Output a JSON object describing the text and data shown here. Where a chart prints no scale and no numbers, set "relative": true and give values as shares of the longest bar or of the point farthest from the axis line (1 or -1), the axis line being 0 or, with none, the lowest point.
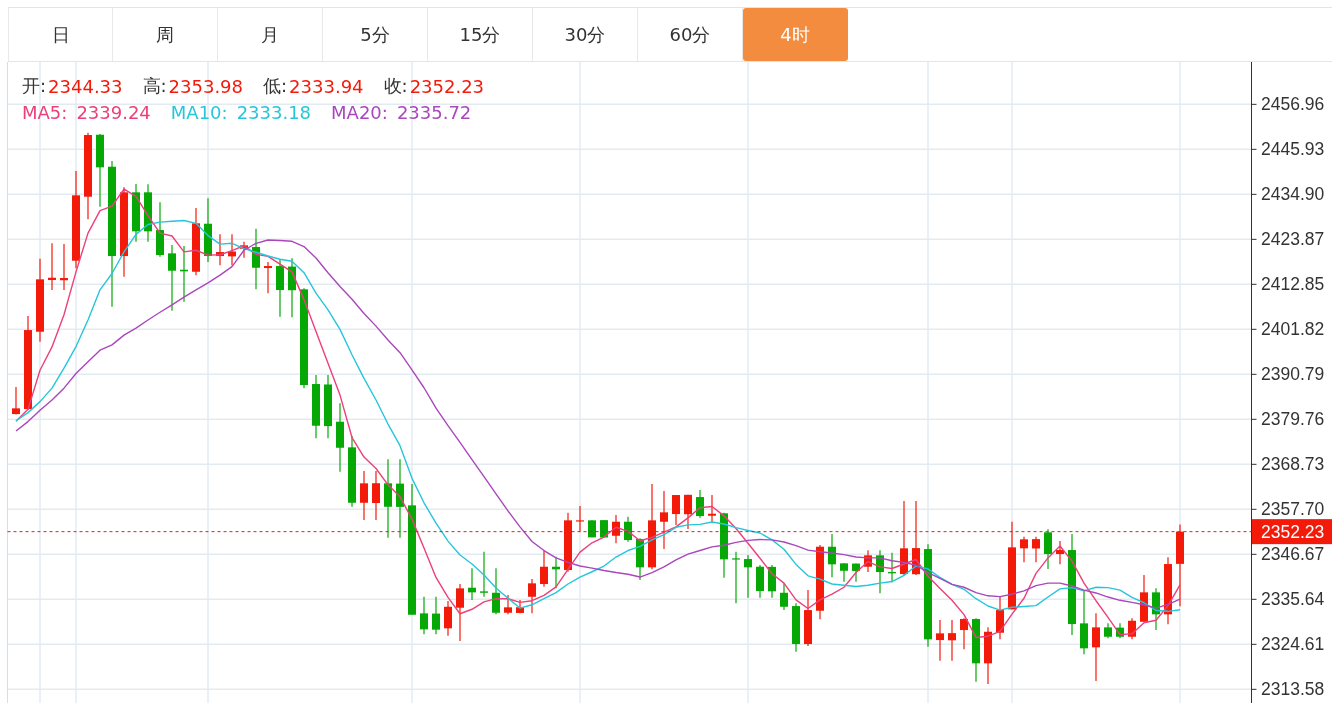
{
  "tabs": [
    {
      "label": "日",
      "selected": false
    },
    {
      "label": "周",
      "selected": false
    },
    {
      "label": "月",
      "selected": false
    },
    {
      "label": "5分",
      "selected": false
    },
    {
      "label": "15分",
      "selected": false
    },
    {
      "label": "30分",
      "selected": false
    },
    {
      "label": "60分",
      "selected": false
    },
    {
      "label": "4时",
      "selected": true
    }
  ],
  "chart": {
    "ohlc_legend": [
      {
        "label": "开:",
        "value": "2344.33"
      },
      {
        "label": "高:",
        "value": "2353.98"
      },
      {
        "label": "低:",
        "value": "2333.94"
      },
      {
        "label": "收:",
        "value": "2352.23"
      }
    ],
    "ma_values": [
      "2339.24",
      "2333.18",
      "2335.72"
    ],
    "last_price_tag": {
      "label": "2352.23"
    },
    "chart_data": {
      "type": "candlestick",
      "ylim": [
        2310.23,
        2467.34
      ],
      "yticks": [
        {
          "value": 2456.96,
          "label": "2456.96"
        },
        {
          "value": 2445.93,
          "label": "2445.93"
        },
        {
          "value": 2434.9,
          "label": "2434.90"
        },
        {
          "value": 2423.87,
          "label": "2423.87"
        },
        {
          "value": 2412.85,
          "label": "2412.85"
        },
        {
          "value": 2401.82,
          "label": "2401.82"
        },
        {
          "value": 2390.79,
          "label": "2390.79"
        },
        {
          "value": 2379.76,
          "label": "2379.76"
        },
        {
          "value": 2368.73,
          "label": "2368.73"
        },
        {
          "value": 2357.7,
          "label": "2357.70"
        },
        {
          "value": 2346.67,
          "label": "2346.67"
        },
        {
          "value": 2335.64,
          "label": "2335.64"
        },
        {
          "value": 2324.61,
          "label": "2324.61"
        },
        {
          "value": 2313.58,
          "label": "2313.58"
        }
      ],
      "grid": true,
      "ohlc": [
        [
          2381.05,
          2387.67,
          2380.93,
          2382.45
        ],
        [
          2382.28,
          2405.08,
          2382.03,
          2401.64
        ],
        [
          2401.23,
          2419.12,
          2398.78,
          2414.07
        ],
        [
          2413.9,
          2422.89,
          2411.45,
          2414.46
        ],
        [
          2413.85,
          2422.72,
          2411.45,
          2414.4
        ],
        [
          2418.63,
          2440.62,
          2416.77,
          2434.66
        ],
        [
          2434.32,
          2450.0,
          2428.78,
          2449.44
        ],
        [
          2449.51,
          2449.69,
          2431.87,
          2441.52
        ],
        [
          2441.67,
          2443.07,
          2407.35,
          2419.78
        ],
        [
          2419.78,
          2436.62,
          2414.71,
          2435.4
        ],
        [
          2435.4,
          2437.43,
          2423.29,
          2425.84
        ],
        [
          2435.4,
          2437.36,
          2423.29,
          2425.84
        ],
        [
          2426.15,
          2432.94,
          2419.61,
          2420.03
        ],
        [
          2420.44,
          2422.48,
          2406.37,
          2416.18
        ],
        [
          2416.42,
          2422.24,
          2408.58,
          2416.03
        ],
        [
          2415.93,
          2431.55,
          2415.05,
          2427.8
        ],
        [
          2427.7,
          2433.92,
          2418.31,
          2419.78
        ],
        [
          2419.78,
          2425.1,
          2417.5,
          2420.76
        ],
        [
          2419.7,
          2425.1,
          2417.5,
          2420.9
        ],
        [
          2421.57,
          2423.29,
          2419.36,
          2422.4
        ],
        [
          2421.99,
          2426.47,
          2411.62,
          2416.91
        ],
        [
          2416.84,
          2418.31,
          2410.64,
          2417.33
        ],
        [
          2417.33,
          2419.05,
          2404.9,
          2411.45
        ],
        [
          2417.2,
          2419.22,
          2404.75,
          2411.4
        ],
        [
          2411.62,
          2411.86,
          2387.35,
          2388.16
        ],
        [
          2388.41,
          2390.61,
          2375.1,
          2378.19
        ],
        [
          2388.3,
          2390.61,
          2375.1,
          2378.1
        ],
        [
          2379.17,
          2383.68,
          2366.91,
          2372.79
        ],
        [
          2372.89,
          2375.66,
          2358.33,
          2359.31
        ],
        [
          2359.31,
          2367.08,
          2355.07,
          2364.07
        ],
        [
          2359.25,
          2367.08,
          2355.07,
          2364.1
        ],
        [
          2364.07,
          2369.95,
          2350.73,
          2358.33
        ],
        [
          2364.0,
          2369.95,
          2350.73,
          2358.3
        ],
        [
          2358.67,
          2363.9,
          2331.86,
          2331.86
        ],
        [
          2332.2,
          2336.27,
          2327.06,
          2328.28
        ],
        [
          2332.15,
          2336.27,
          2327.06,
          2328.2
        ],
        [
          2328.53,
          2335.22,
          2326.71,
          2333.82
        ],
        [
          2333.58,
          2339.39,
          2325.41,
          2338.33
        ],
        [
          2338.48,
          2343.23,
          2335.46,
          2337.35
        ],
        [
          2337.59,
          2347.3,
          2336.27,
          2337.25
        ],
        [
          2337.25,
          2343.23,
          2331.96,
          2332.35
        ],
        [
          2332.35,
          2336.69,
          2331.96,
          2333.68
        ],
        [
          2332.3,
          2335.46,
          2332.2,
          2333.7
        ],
        [
          2336.27,
          2340.61,
          2332.2,
          2339.56
        ],
        [
          2339.39,
          2347.65,
          2338.72,
          2343.63
        ],
        [
          2343.63,
          2346.08,
          2338.33,
          2342.99
        ],
        [
          2342.82,
          2356.86,
          2342.4,
          2355.0
        ],
        [
          2354.75,
          2358.5,
          2352.2,
          2355.0
        ],
        [
          2355.0,
          2355.0,
          2350.83,
          2350.83
        ],
        [
          2355.05,
          2355.05,
          2350.8,
          2350.8
        ],
        [
          2351.22,
          2356.3,
          2349.36,
          2354.66
        ],
        [
          2354.66,
          2355.88,
          2349.76,
          2350.17
        ],
        [
          2350.42,
          2350.59,
          2340.37,
          2343.48
        ],
        [
          2343.48,
          2363.9,
          2342.99,
          2355.0
        ],
        [
          2354.66,
          2362.18,
          2347.96,
          2356.96
        ],
        [
          2356.54,
          2361.2,
          2353.85,
          2361.2
        ],
        [
          2356.5,
          2361.25,
          2352.87,
          2361.25
        ],
        [
          2360.71,
          2362.43,
          2355.64,
          2356.05
        ],
        [
          2356.13,
          2361.2,
          2354.66,
          2356.62
        ],
        [
          2356.72,
          2356.86,
          2340.93,
          2345.44
        ],
        [
          2345.68,
          2347.3,
          2334.65,
          2345.44
        ],
        [
          2345.51,
          2346.49,
          2336.03,
          2343.48
        ],
        [
          2343.63,
          2344.04,
          2336.03,
          2337.67
        ],
        [
          2343.6,
          2344.04,
          2336.03,
          2337.6
        ],
        [
          2337.25,
          2339.56,
          2333.01,
          2333.82
        ],
        [
          2333.99,
          2334.65,
          2322.79,
          2324.68
        ],
        [
          2324.68,
          2337.91,
          2324.19,
          2333.01
        ],
        [
          2332.84,
          2348.94,
          2330.73,
          2348.53
        ],
        [
          2348.53,
          2351.64,
          2341.03,
          2344.22
        ],
        [
          2344.46,
          2344.46,
          2339.95,
          2342.64
        ],
        [
          2344.4,
          2344.4,
          2339.95,
          2342.6
        ],
        [
          2343.63,
          2347.65,
          2342.33,
          2346.42
        ],
        [
          2346.42,
          2347.65,
          2337.1,
          2342.33
        ],
        [
          2342.33,
          2347.06,
          2339.8,
          2342.01
        ],
        [
          2341.84,
          2359.73,
          2341.6,
          2348.14
        ],
        [
          2341.8,
          2359.73,
          2341.6,
          2348.2
        ],
        [
          2347.96,
          2349.11,
          2324.02,
          2325.83
        ],
        [
          2325.66,
          2330.56,
          2320.59,
          2327.3
        ],
        [
          2325.6,
          2330.56,
          2320.59,
          2327.35
        ],
        [
          2328.11,
          2330.98,
          2323.38,
          2330.81
        ],
        [
          2330.81,
          2330.98,
          2315.44,
          2319.95
        ],
        [
          2319.95,
          2328.77,
          2314.88,
          2327.69
        ],
        [
          2327.45,
          2336.44,
          2325.83,
          2333.01
        ],
        [
          2333.18,
          2354.66,
          2333.18,
          2348.38
        ],
        [
          2348.14,
          2350.98,
          2344.71,
          2350.34
        ],
        [
          2348.1,
          2350.98,
          2344.71,
          2350.4
        ],
        [
          2352.06,
          2352.79,
          2343.06,
          2346.74
        ],
        [
          2346.74,
          2349.92,
          2344.22,
          2347.72
        ],
        [
          2347.72,
          2351.64,
          2326.88,
          2329.58
        ],
        [
          2329.75,
          2337.91,
          2322.15,
          2323.63
        ],
        [
          2323.87,
          2332.2,
          2315.61,
          2328.77
        ],
        [
          2328.77,
          2329.75,
          2326.08,
          2326.47
        ],
        [
          2328.7,
          2329.75,
          2326.08,
          2326.47
        ],
        [
          2326.47,
          2330.98,
          2325.83,
          2330.39
        ],
        [
          2330.14,
          2341.59,
          2330.14,
          2337.35
        ],
        [
          2337.35,
          2338.33,
          2328.11,
          2331.96
        ],
        [
          2331.96,
          2345.93,
          2329.51,
          2344.29
        ],
        [
          2344.33,
          2353.98,
          2333.94,
          2352.23
        ]
      ]
    },
    "moving_averages": {
      "chart_data": {
        "type": "line",
        "relative": true,
        "ylim": [
          2310.23,
          2467.34
        ],
        "series": [
          {
            "name": "MA5:",
            "color": "#ec407a",
            "values": [
              2379.3,
              2382.2,
              2391.8,
              2397.5,
              2405.4,
              2415.9,
              2425.4,
              2430.9,
              2432.0,
              2436.2,
              2434.4,
              2429.7,
              2425.4,
              2424.7,
              2420.8,
              2421.2,
              2420.0,
              2420.1,
              2421.1,
              2422.3,
              2420.2,
              2419.7,
              2417.8,
              2415.9,
              2409.1,
              2401.3,
              2393.5,
              2385.7,
              2375.3,
              2370.5,
              2367.7,
              2363.7,
              2360.8,
              2355.3,
              2348.2,
              2341.0,
              2336.1,
              2332.1,
              2333.2,
              2335.0,
              2335.8,
              2335.8,
              2334.9,
              2335.3,
              2336.6,
              2338.7,
              2343.0,
              2347.2,
              2349.5,
              2350.9,
              2353.3,
              2352.3,
              2350.0,
              2350.8,
              2352.1,
              2353.4,
              2355.6,
              2358.1,
              2358.4,
              2356.1,
              2353.0,
              2349.4,
              2345.7,
              2341.9,
              2339.6,
              2335.5,
              2333.4,
              2335.5,
              2336.9,
              2338.6,
              2342.2,
              2344.9,
              2343.6,
              2343.2,
              2344.3,
              2345.4,
              2341.3,
              2338.3,
              2335.4,
              2331.9,
              2326.3,
              2326.6,
              2327.8,
              2332.0,
              2335.9,
              2342.0,
              2345.8,
              2348.7,
              2345.0,
              2339.6,
              2335.3,
              2331.2,
              2327.0,
              2327.2,
              2329.9,
              2330.5,
              2334.1,
              2339.2
            ]
          },
          {
            "name": "MA10:",
            "color": "#26c6da",
            "values": [
              2379.4,
              2381.4,
              2384.1,
              2387.4,
              2392.3,
              2397.6,
              2404.1,
              2411.5,
              2415.5,
              2420.8,
              2425.1,
              2427.5,
              2428.1,
              2428.3,
              2428.5,
              2427.8,
              2424.8,
              2422.7,
              2422.9,
              2421.6,
              2420.7,
              2419.8,
              2419.0,
              2418.5,
              2415.7,
              2410.7,
              2406.6,
              2401.8,
              2395.6,
              2389.8,
              2384.5,
              2378.6,
              2373.3,
              2365.3,
              2359.3,
              2354.3,
              2349.9,
              2346.5,
              2344.3,
              2341.6,
              2338.4,
              2335.9,
              2333.5,
              2334.3,
              2335.8,
              2337.3,
              2339.4,
              2341.1,
              2342.4,
              2343.8,
              2346.0,
              2347.6,
              2348.6,
              2350.2,
              2351.5,
              2353.3,
              2353.9,
              2354.0,
              2354.6,
              2354.1,
              2353.2,
              2352.5,
              2351.9,
              2350.2,
              2347.9,
              2344.2,
              2341.4,
              2340.6,
              2339.4,
              2339.1,
              2338.8,
              2339.1,
              2339.6,
              2340.0,
              2341.5,
              2343.8,
              2343.1,
              2341.0,
              2339.3,
              2338.1,
              2335.8,
              2334.0,
              2333.0,
              2333.7,
              2333.9,
              2334.1,
              2336.2,
              2338.2,
              2338.5,
              2337.7,
              2338.6,
              2338.5,
              2337.9,
              2336.1,
              2334.8,
              2332.9,
              2332.7,
              2333.1
            ]
          },
          {
            "name": "MA20:",
            "color": "#ab47bc",
            "values": [
              2376.9,
              2379.2,
              2382.0,
              2384.5,
              2387.4,
              2391.0,
              2393.9,
              2396.7,
              2398.0,
              2400.4,
              2402.1,
              2404.1,
              2406.0,
              2407.8,
              2409.7,
              2411.5,
              2413.2,
              2415.1,
              2417.2,
              2421.2,
              2422.9,
              2423.7,
              2423.6,
              2423.4,
              2422.1,
              2419.3,
              2415.7,
              2412.3,
              2409.2,
              2405.7,
              2402.6,
              2399.2,
              2396.1,
              2391.9,
              2387.5,
              2382.5,
              2378.2,
              2374.1,
              2369.9,
              2365.7,
              2361.5,
              2357.3,
              2353.4,
              2349.8,
              2347.6,
              2345.8,
              2344.7,
              2343.8,
              2343.3,
              2342.7,
              2342.2,
              2341.8,
              2341.1,
              2342.2,
              2343.6,
              2345.3,
              2346.7,
              2347.6,
              2348.5,
              2348.9,
              2349.6,
              2350.1,
              2350.3,
              2350.2,
              2349.7,
              2348.8,
              2347.7,
              2347.3,
              2347.0,
              2346.6,
              2346.0,
              2345.8,
              2345.8,
              2345.1,
              2344.7,
              2344.0,
              2342.2,
              2340.8,
              2339.3,
              2338.6,
              2337.3,
              2336.5,
              2336.3,
              2336.9,
              2337.7,
              2339.0,
              2339.6,
              2339.6,
              2338.9,
              2337.9,
              2337.2,
              2336.2,
              2335.4,
              2334.9,
              2334.3,
              2333.5,
              2334.4,
              2335.7
            ]
          }
        ]
      }
    }
  }
}
